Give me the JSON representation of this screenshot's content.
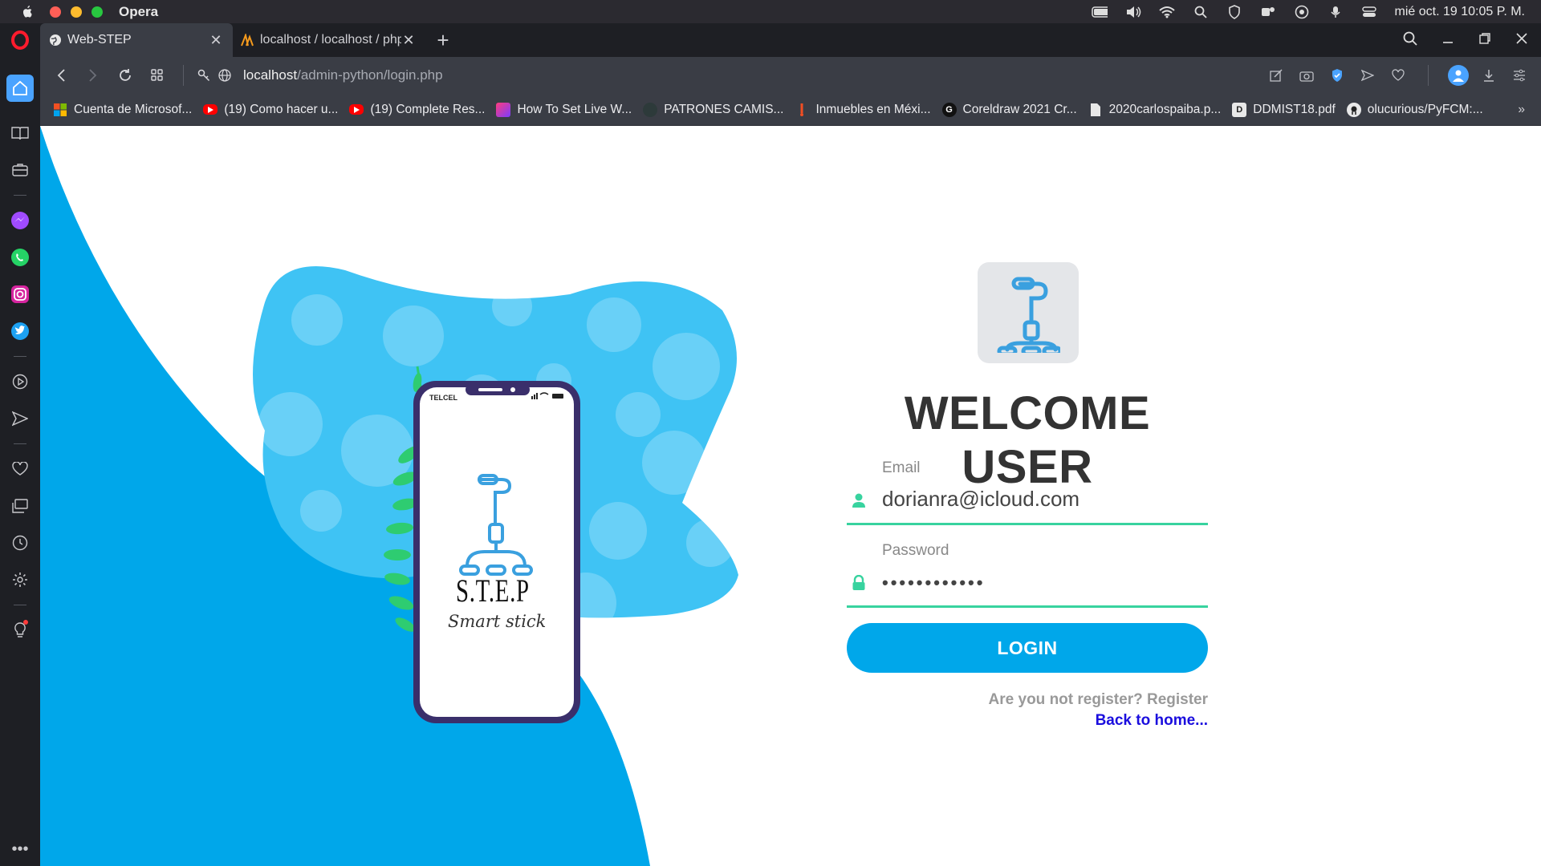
{
  "menubar": {
    "app_name": "Opera",
    "datetime": "mié oct. 19 10:05 P. M."
  },
  "tabs": [
    {
      "label": "Web-STEP"
    },
    {
      "label": "localhost / localhost / php..."
    }
  ],
  "address": {
    "host": "localhost",
    "path": "/admin-python/login.php"
  },
  "bookmarks": [
    {
      "label": "Cuenta de Microsof...",
      "icon": "microsoft-icon"
    },
    {
      "label": "(19) Como hacer u...",
      "icon": "youtube-icon"
    },
    {
      "label": "(19) Complete Res...",
      "icon": "youtube-icon"
    },
    {
      "label": "How To Set Live W...",
      "icon": "site-icon"
    },
    {
      "label": "PATRONES CAMIS...",
      "icon": "site-icon"
    },
    {
      "label": "Inmuebles en Méxi...",
      "icon": "site-icon"
    },
    {
      "label": "Coreldraw 2021 Cr...",
      "icon": "g-icon"
    },
    {
      "label": "2020carlospaiba.p...",
      "icon": "file-icon"
    },
    {
      "label": "DDMIST18.pdf",
      "icon": "d-icon"
    },
    {
      "label": "olucurious/PyFCM:...",
      "icon": "github-icon"
    }
  ],
  "phone": {
    "carrier": "TELCEL",
    "brand": "S.T.E.P",
    "tagline": "Smart stick"
  },
  "login": {
    "title": "WELCOME USER",
    "email_label": "Email",
    "email_value": "dorianra@icloud.com",
    "password_label": "Password",
    "password_value": "••••••••••••",
    "button": "LOGIN",
    "register_text": "Are you not register? Register",
    "back_link": "Back to home..."
  },
  "colors": {
    "accent_blue": "#00a7ea",
    "accent_green": "#38d39f",
    "link_blue": "#1a0dde"
  }
}
